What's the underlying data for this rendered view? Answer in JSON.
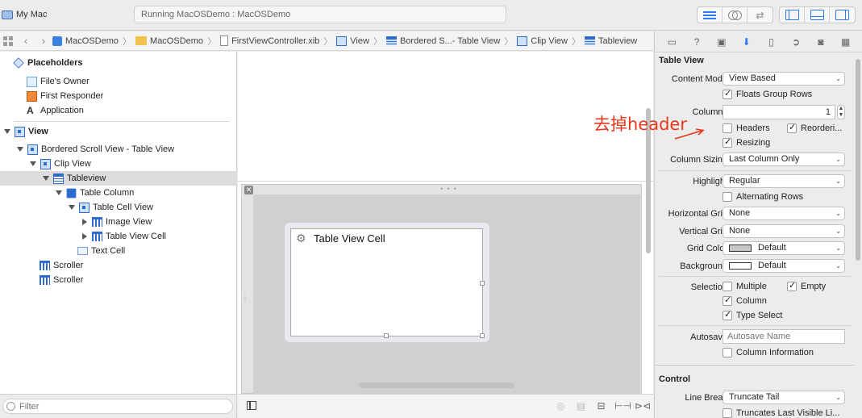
{
  "toolbar": {
    "scheme": "My Mac",
    "status": "Running MacOSDemo : MacOSDemo"
  },
  "jumpbar": {
    "crumbs": [
      "MacOSDemo",
      "MacOSDemo",
      "FirstViewController.xib",
      "View",
      "Bordered S...- Table View",
      "Clip View",
      "Tableview"
    ]
  },
  "outline": {
    "placeholders": "Placeholders",
    "files_owner": "File's Owner",
    "first_responder": "First Responder",
    "application": "Application",
    "view": "View",
    "bordered_scroll_view": "Bordered Scroll View - Table View",
    "clip_view": "Clip View",
    "tableview": "Tableview",
    "table_column": "Table Column",
    "table_cell_view": "Table Cell View",
    "image_view": "Image View",
    "table_view_cell": "Table View Cell",
    "text_cell": "Text Cell",
    "scroller_1": "Scroller",
    "scroller_2": "Scroller",
    "filter_placeholder": "Filter"
  },
  "canvas": {
    "cell_label": "Table View Cell"
  },
  "inspector": {
    "section_title": "Table View",
    "content_mode_label": "Content Mode",
    "content_mode_value": "View Based",
    "floats_group_rows": "Floats Group Rows",
    "columns_label": "Columns",
    "columns_value": "1",
    "headers": "Headers",
    "reordering": "Reorderi...",
    "resizing": "Resizing",
    "column_sizing_label": "Column Sizing",
    "column_sizing_value": "Last Column Only",
    "highlight_label": "Highlight",
    "highlight_value": "Regular",
    "alternating_rows": "Alternating Rows",
    "horizontal_grid_label": "Horizontal Grid",
    "horizontal_grid_value": "None",
    "vertical_grid_label": "Vertical Grid",
    "vertical_grid_value": "None",
    "grid_color_label": "Grid Color",
    "grid_color_value": "Default",
    "background_label": "Background",
    "background_value": "Default",
    "selection_label": "Selection",
    "multiple": "Multiple",
    "empty": "Empty",
    "column": "Column",
    "type_select": "Type Select",
    "autosave_label": "Autosave",
    "autosave_placeholder": "Autosave Name",
    "column_information": "Column Information",
    "control_title": "Control",
    "line_break_label": "Line Break",
    "line_break_value": "Truncate Tail",
    "truncates_last": "Truncates Last Visible Li..."
  },
  "annotation": {
    "text": "去掉header",
    "color": "#e8381c"
  },
  "colors": {
    "accent": "#2f7cf6",
    "selection": "#dcdcdc"
  }
}
